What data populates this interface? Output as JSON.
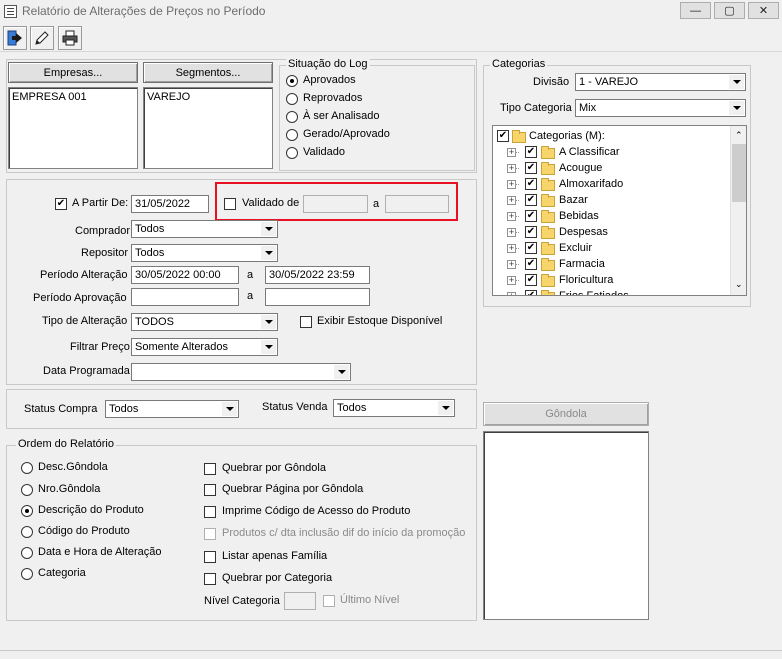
{
  "window": {
    "title": "Relatório de Alterações de Preços no Período",
    "minimize": "—",
    "maximize": "▢",
    "close": "✕"
  },
  "toolbar": {
    "icons": [
      "exit-icon",
      "pencil-icon",
      "printer-icon"
    ]
  },
  "empresas": {
    "button": "Empresas...",
    "items": [
      "EMPRESA 001"
    ]
  },
  "segmentos": {
    "button": "Segmentos...",
    "items": [
      "VAREJO"
    ]
  },
  "situacao_log": {
    "legend": "Situação do Log",
    "options": [
      "Aprovados",
      "Reprovados",
      "À ser Analisado",
      "Gerado/Aprovado",
      "Validado"
    ],
    "selected": 0
  },
  "categorias": {
    "legend": "Categorias",
    "divisao_label": "Divisão",
    "divisao_value": "1 - VAREJO",
    "tipo_label": "Tipo Categoria",
    "tipo_value": "Mix",
    "root": "Categorias (M):",
    "items": [
      "A Classificar",
      "Acougue",
      "Almoxarifado",
      "Bazar",
      "Bebidas",
      "Despesas",
      "Excluir",
      "Farmacia",
      "Floricultura",
      "Frios Fatiados"
    ]
  },
  "filters": {
    "a_partir_label": "A Partir De:",
    "a_partir_value": "31/05/2022",
    "a_partir_checked": true,
    "validado_label": "Validado de",
    "validado_from": "",
    "validado_sep": "a",
    "validado_to": "",
    "comprador_label": "Comprador",
    "comprador_value": "Todos",
    "repositor_label": "Repositor",
    "repositor_value": "Todos",
    "periodo_alt_label": "Período Alteração",
    "periodo_alt_from": "30/05/2022  00:00",
    "periodo_alt_sep": "a",
    "periodo_alt_to": "30/05/2022  23:59",
    "periodo_apr_label": "Período Aprovação",
    "periodo_apr_from": "",
    "periodo_apr_sep": "a",
    "periodo_apr_to": "",
    "tipo_alt_label": "Tipo de Alteração",
    "tipo_alt_value": "TODOS",
    "exibir_estoque_label": "Exibir Estoque Disponível",
    "filtrar_preco_label": "Filtrar Preço",
    "filtrar_preco_value": "Somente Alterados",
    "data_programada_label": "Data Programada",
    "data_programada_value": ""
  },
  "status": {
    "compra_label": "Status Compra",
    "compra_value": "Todos",
    "venda_label": "Status Venda",
    "venda_value": "Todos"
  },
  "gondola": {
    "button": "Gôndola"
  },
  "ordem": {
    "legend": "Ordem do Relatório",
    "options": [
      "Desc.Gôndola",
      "Nro.Gôndola",
      "Descrição do Produto",
      "Código do Produto",
      "Data e Hora de Alteração",
      "Categoria"
    ],
    "selected": 2,
    "checks": [
      {
        "label": "Quebrar por Gôndola",
        "checked": false,
        "disabled": false
      },
      {
        "label": "Quebrar Página por Gôndola",
        "checked": false,
        "disabled": false
      },
      {
        "label": "Imprime Código de Acesso do Produto",
        "checked": false,
        "disabled": false
      },
      {
        "label": "Produtos c/ dta inclusão dif do início da promoção",
        "checked": false,
        "disabled": true
      },
      {
        "label": "Listar apenas Família",
        "checked": false,
        "disabled": false
      },
      {
        "label": "Quebrar por Categoria",
        "checked": false,
        "disabled": false
      }
    ],
    "nivel_label": "Nível Categoria",
    "nivel_value": "",
    "ultimo_nivel_label": "Último Nível"
  }
}
